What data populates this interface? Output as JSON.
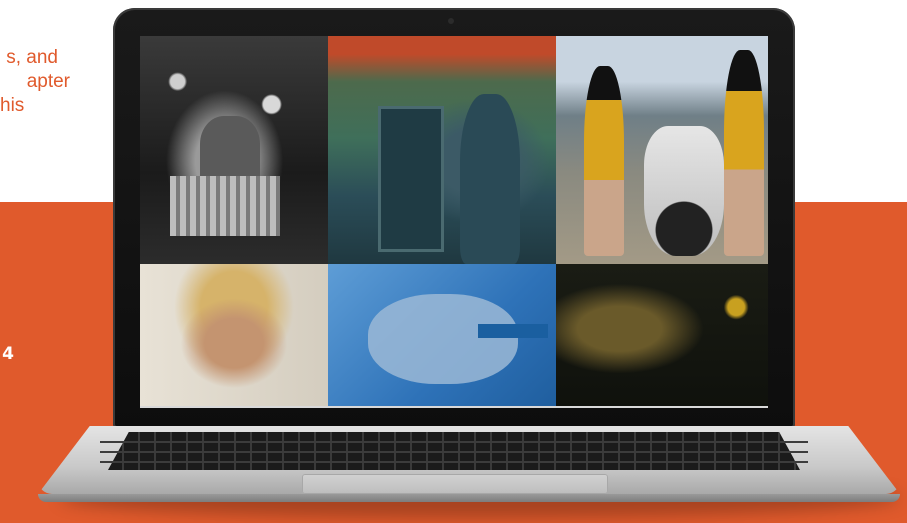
{
  "intro": {
    "lines": [
      "s, and",
      "apter",
      "his"
    ]
  },
  "stat": {
    "value": "4"
  },
  "colors": {
    "accent": "#e05a2c",
    "laptop_frame": "#111111",
    "base": "#d0d0d0"
  },
  "gallery": {
    "tiles": [
      {
        "name": "artwork-market-stall-photo",
        "tone": "black-and-white"
      },
      {
        "name": "artwork-phone-booth-painting",
        "tone": "teal"
      },
      {
        "name": "artwork-three-women-motorcycle",
        "tone": "yellow"
      },
      {
        "name": "artwork-blonde-portrait",
        "tone": "warm"
      },
      {
        "name": "artwork-hands-over-face",
        "tone": "blue"
      },
      {
        "name": "artwork-dark-portrait",
        "tone": "dark"
      }
    ]
  }
}
